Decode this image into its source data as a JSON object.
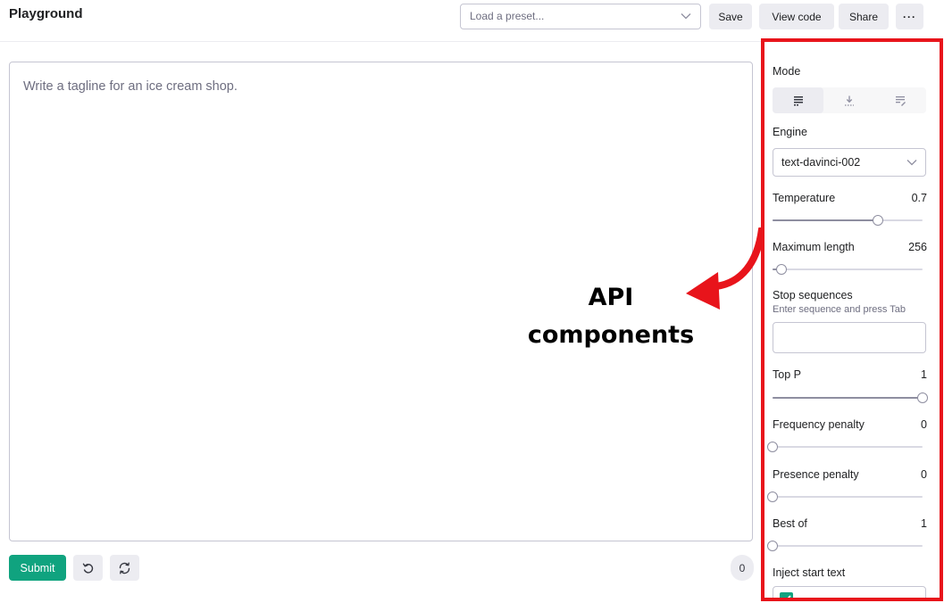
{
  "header": {
    "title": "Playground",
    "preset_placeholder": "Load a preset...",
    "save_label": "Save",
    "view_code_label": "View code",
    "share_label": "Share",
    "more_label": "···"
  },
  "editor": {
    "prompt_text": "Write a tagline for an ice cream shop.",
    "submit_label": "Submit",
    "undo_icon": "undo-icon",
    "regenerate_icon": "regenerate-icon",
    "token_count": "0"
  },
  "annotation": {
    "line1": "API",
    "line2": "components",
    "box_color": "#e8141b"
  },
  "settings": {
    "mode": {
      "label": "Mode",
      "options": [
        "complete-icon",
        "insert-icon",
        "edit-icon"
      ],
      "selected": 0
    },
    "engine": {
      "label": "Engine",
      "value": "text-davinci-002"
    },
    "temperature": {
      "label": "Temperature",
      "value": "0.7",
      "fraction": 0.7
    },
    "maximum_length": {
      "label": "Maximum length",
      "value": "256",
      "fraction": 0.06
    },
    "stop_sequences": {
      "label": "Stop sequences",
      "hint": "Enter sequence and press Tab"
    },
    "top_p": {
      "label": "Top P",
      "value": "1",
      "fraction": 1.0
    },
    "frequency_penalty": {
      "label": "Frequency penalty",
      "value": "0",
      "fraction": 0.0
    },
    "presence_penalty": {
      "label": "Presence penalty",
      "value": "0",
      "fraction": 0.0
    },
    "best_of": {
      "label": "Best of",
      "value": "1",
      "fraction": 0.0
    },
    "inject_start_text": {
      "label": "Inject start text",
      "checked": true
    }
  },
  "colors": {
    "accent": "#10a37f",
    "annotation_red": "#e8141b"
  }
}
